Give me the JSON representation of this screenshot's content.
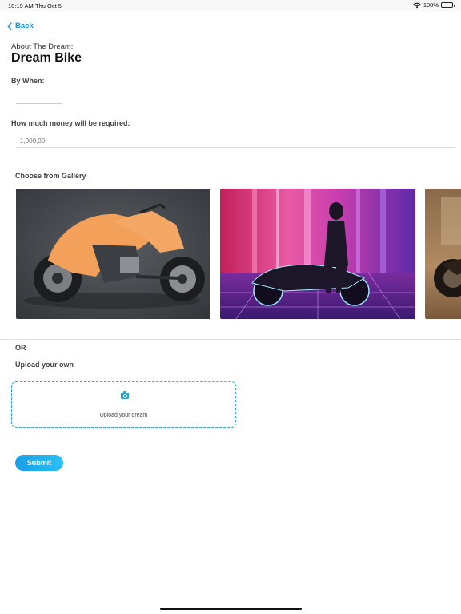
{
  "status_bar": {
    "time": "10:19 AM",
    "date": "Thu Oct 5",
    "battery": "100%",
    "battery_level": 1.0
  },
  "nav": {
    "back_label": "Back"
  },
  "header": {
    "about_label": "About The Dream:",
    "title": "Dream Bike"
  },
  "form": {
    "by_when_label": "By When:",
    "by_when_value": "",
    "money_label": "How much money will be required:",
    "money_placeholder": "1,000,00"
  },
  "gallery": {
    "label": "Choose from Gallery",
    "items": [
      {
        "name": "orange-motorcycle-image"
      },
      {
        "name": "neon-motorcycle-image"
      },
      {
        "name": "vintage-motorcycle-image"
      }
    ]
  },
  "or_label": "OR",
  "upload": {
    "label": "Upload your own",
    "button_text": "Upload your dream",
    "icon": "camera-icon",
    "border_color": "#2aa5d8"
  },
  "submit_label": "Submit",
  "colors": {
    "accent": "#1a8fd6"
  }
}
